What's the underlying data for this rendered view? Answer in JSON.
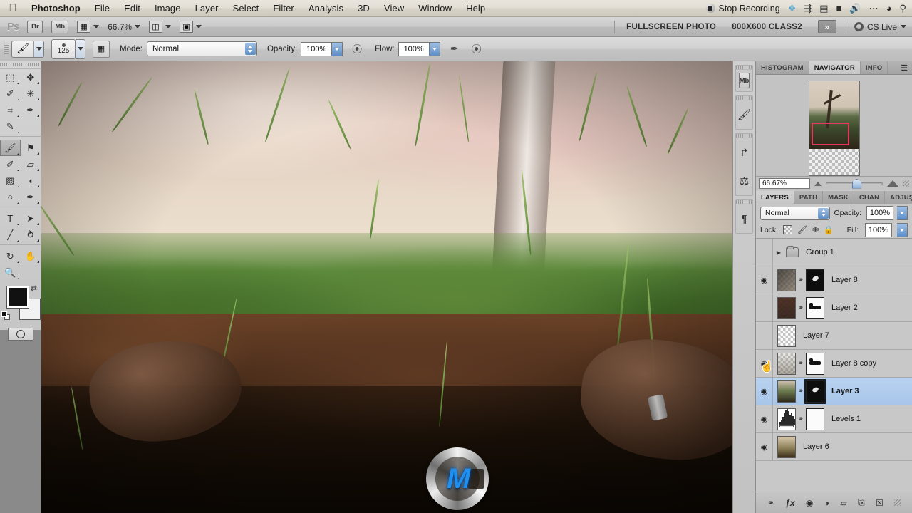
{
  "macmenu": {
    "apple_icon": "apple-logo",
    "items": [
      "Photoshop",
      "File",
      "Edit",
      "Image",
      "Layer",
      "Select",
      "Filter",
      "Analysis",
      "3D",
      "View",
      "Window",
      "Help"
    ],
    "status": {
      "record_label": "Stop Recording",
      "icons": [
        "dropbox-icon",
        "airplay-icon",
        "display-icon",
        "battery-icon",
        "volume-icon",
        "bluetooth-icon",
        "wifi-icon",
        "search-icon"
      ]
    }
  },
  "appbar": {
    "ps_logo": "Ps",
    "bridge_label": "Br",
    "minibridge_label": "Mb",
    "zoom_value": "66.7%",
    "doc_title": "FULLSCREEN PHOTO",
    "doc_size": "800X600 CLASS2",
    "overflow_label": "»",
    "cs_live_label": "CS Live"
  },
  "options": {
    "brush_size": "125",
    "mode_label": "Mode:",
    "mode_value": "Normal",
    "opacity_label": "Opacity:",
    "opacity_value": "100%",
    "flow_label": "Flow:",
    "flow_value": "100%"
  },
  "tools": {
    "items": [
      {
        "name": "marquee-tool",
        "glyph": "⬚"
      },
      {
        "name": "move-tool",
        "glyph": "✥"
      },
      {
        "name": "lasso-tool",
        "glyph": "✐"
      },
      {
        "name": "magic-wand-tool",
        "glyph": "✳"
      },
      {
        "name": "crop-tool",
        "glyph": "⌗"
      },
      {
        "name": "eyedropper-tool",
        "glyph": "✒"
      },
      {
        "name": "healing-brush-tool",
        "glyph": "✎"
      },
      {
        "name": "brush-tool",
        "glyph": "🖌"
      },
      {
        "name": "clone-stamp-tool",
        "glyph": "⚑"
      },
      {
        "name": "history-brush-tool",
        "glyph": "✐"
      },
      {
        "name": "eraser-tool",
        "glyph": "▱"
      },
      {
        "name": "gradient-tool",
        "glyph": "▨"
      },
      {
        "name": "blur-tool",
        "glyph": "◖"
      },
      {
        "name": "dodge-tool",
        "glyph": "○"
      },
      {
        "name": "pen-tool",
        "glyph": "✒"
      },
      {
        "name": "type-tool",
        "glyph": "T"
      },
      {
        "name": "path-selection-tool",
        "glyph": "➤"
      },
      {
        "name": "line-tool",
        "glyph": "╱"
      },
      {
        "name": "rotate-3d-tool",
        "glyph": "⥁"
      },
      {
        "name": "orbit-3d-tool",
        "glyph": "↻"
      },
      {
        "name": "hand-tool",
        "glyph": "✋"
      },
      {
        "name": "zoom-tool",
        "glyph": "🔍"
      }
    ],
    "selected_index": 7,
    "foreground_color": "#111111",
    "background_color": "#f2f2f2"
  },
  "dock": {
    "items": [
      {
        "name": "mini-bridge-icon",
        "label": "Mb"
      },
      {
        "name": "brushes-icon",
        "glyph": "🖌"
      },
      {
        "name": "actions-icon",
        "glyph": "↱"
      },
      {
        "name": "clone-source-icon",
        "glyph": "⚑"
      },
      {
        "name": "paragraph-icon",
        "glyph": "¶"
      }
    ]
  },
  "navigator": {
    "tabs": [
      {
        "label": "HISTOGRAM",
        "active": false
      },
      {
        "label": "NAVIGATOR",
        "active": true
      },
      {
        "label": "INFO",
        "active": false
      }
    ],
    "zoom_value": "66.67%"
  },
  "layers_panel": {
    "tabs": [
      {
        "label": "LAYERS",
        "active": true
      },
      {
        "label": "PATH",
        "active": false
      },
      {
        "label": "MASK",
        "active": false
      },
      {
        "label": "CHAN",
        "active": false
      },
      {
        "label": "ADJUŞ",
        "active": false
      }
    ],
    "blend_mode": "Normal",
    "opacity_label": "Opacity:",
    "opacity_value": "100%",
    "lock_label": "Lock:",
    "fill_label": "Fill:",
    "fill_value": "100%",
    "layers": [
      {
        "name": "Group 1",
        "type": "group",
        "visible": false,
        "selected": false,
        "has_mask": false,
        "has_link": false
      },
      {
        "name": "Layer 8",
        "type": "layer",
        "visible": true,
        "selected": false,
        "has_mask": true,
        "has_link": true,
        "mask_style": "black"
      },
      {
        "name": "Layer 2",
        "type": "layer",
        "visible": false,
        "selected": false,
        "has_mask": true,
        "has_link": true,
        "mask_style": "white"
      },
      {
        "name": "Layer 7",
        "type": "layer",
        "visible": false,
        "selected": false,
        "has_mask": false,
        "has_link": false
      },
      {
        "name": "Layer 8 copy",
        "type": "layer",
        "visible": true,
        "selected": false,
        "has_mask": true,
        "has_link": true,
        "mask_style": "white"
      },
      {
        "name": "Layer 3",
        "type": "layer",
        "visible": true,
        "selected": true,
        "has_mask": true,
        "has_link": true,
        "mask_style": "black"
      },
      {
        "name": "Levels 1",
        "type": "adjustment",
        "visible": true,
        "selected": false,
        "has_mask": true,
        "has_link": true,
        "mask_style": "plain"
      },
      {
        "name": "Layer 6",
        "type": "layer",
        "visible": true,
        "selected": false,
        "has_mask": false,
        "has_link": false
      }
    ],
    "footer_icons": [
      {
        "name": "link-layers-icon",
        "glyph": "⚭"
      },
      {
        "name": "layer-style-fx-icon",
        "glyph": "ƒx"
      },
      {
        "name": "add-layer-mask-icon",
        "glyph": "◉"
      },
      {
        "name": "new-adjustment-layer-icon",
        "glyph": "◑"
      },
      {
        "name": "new-group-icon",
        "glyph": "▱"
      },
      {
        "name": "new-layer-icon",
        "glyph": "❐"
      },
      {
        "name": "delete-layer-icon",
        "glyph": "🗑"
      }
    ]
  },
  "canvas": {
    "watermark_text": "M"
  },
  "colors": {
    "accent_selection": "#a8c6e9",
    "navigator_view_box": "#e8375f",
    "panel_bg": "#c8c8c8"
  }
}
